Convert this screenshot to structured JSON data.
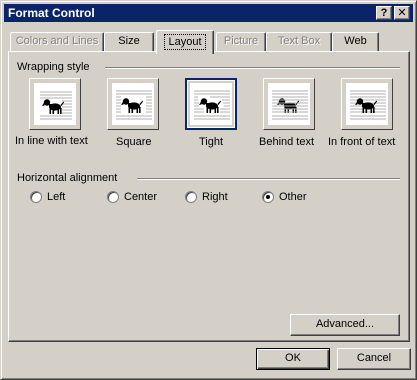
{
  "dialog": {
    "title": "Format Control",
    "help_glyph": "?",
    "close_glyph": "✕"
  },
  "tabs": [
    {
      "label": "Colors and Lines",
      "state": "disabled"
    },
    {
      "label": "Size",
      "state": "enabled"
    },
    {
      "label": "Layout",
      "state": "selected"
    },
    {
      "label": "Picture",
      "state": "disabled"
    },
    {
      "label": "Text Box",
      "state": "disabled"
    },
    {
      "label": "Web",
      "state": "enabled"
    }
  ],
  "wrapping": {
    "group_label": "Wrapping style",
    "selected": "Tight",
    "options": [
      {
        "label": "In line with text",
        "icon": "wrap-inline-icon"
      },
      {
        "label": "Square",
        "icon": "wrap-square-icon"
      },
      {
        "label": "Tight",
        "icon": "wrap-tight-icon"
      },
      {
        "label": "Behind text",
        "icon": "wrap-behind-text-icon"
      },
      {
        "label": "In front of text",
        "icon": "wrap-in-front-of-text-icon"
      }
    ]
  },
  "alignment": {
    "group_label": "Horizontal alignment",
    "selected": "Other",
    "options": [
      {
        "label": "Left"
      },
      {
        "label": "Center"
      },
      {
        "label": "Right"
      },
      {
        "label": "Other"
      }
    ]
  },
  "buttons": {
    "advanced": "Advanced...",
    "ok": "OK",
    "cancel": "Cancel"
  },
  "colors": {
    "titlebar": "#0a246a",
    "face": "#d4d0c8",
    "disabled_text": "#808080"
  }
}
